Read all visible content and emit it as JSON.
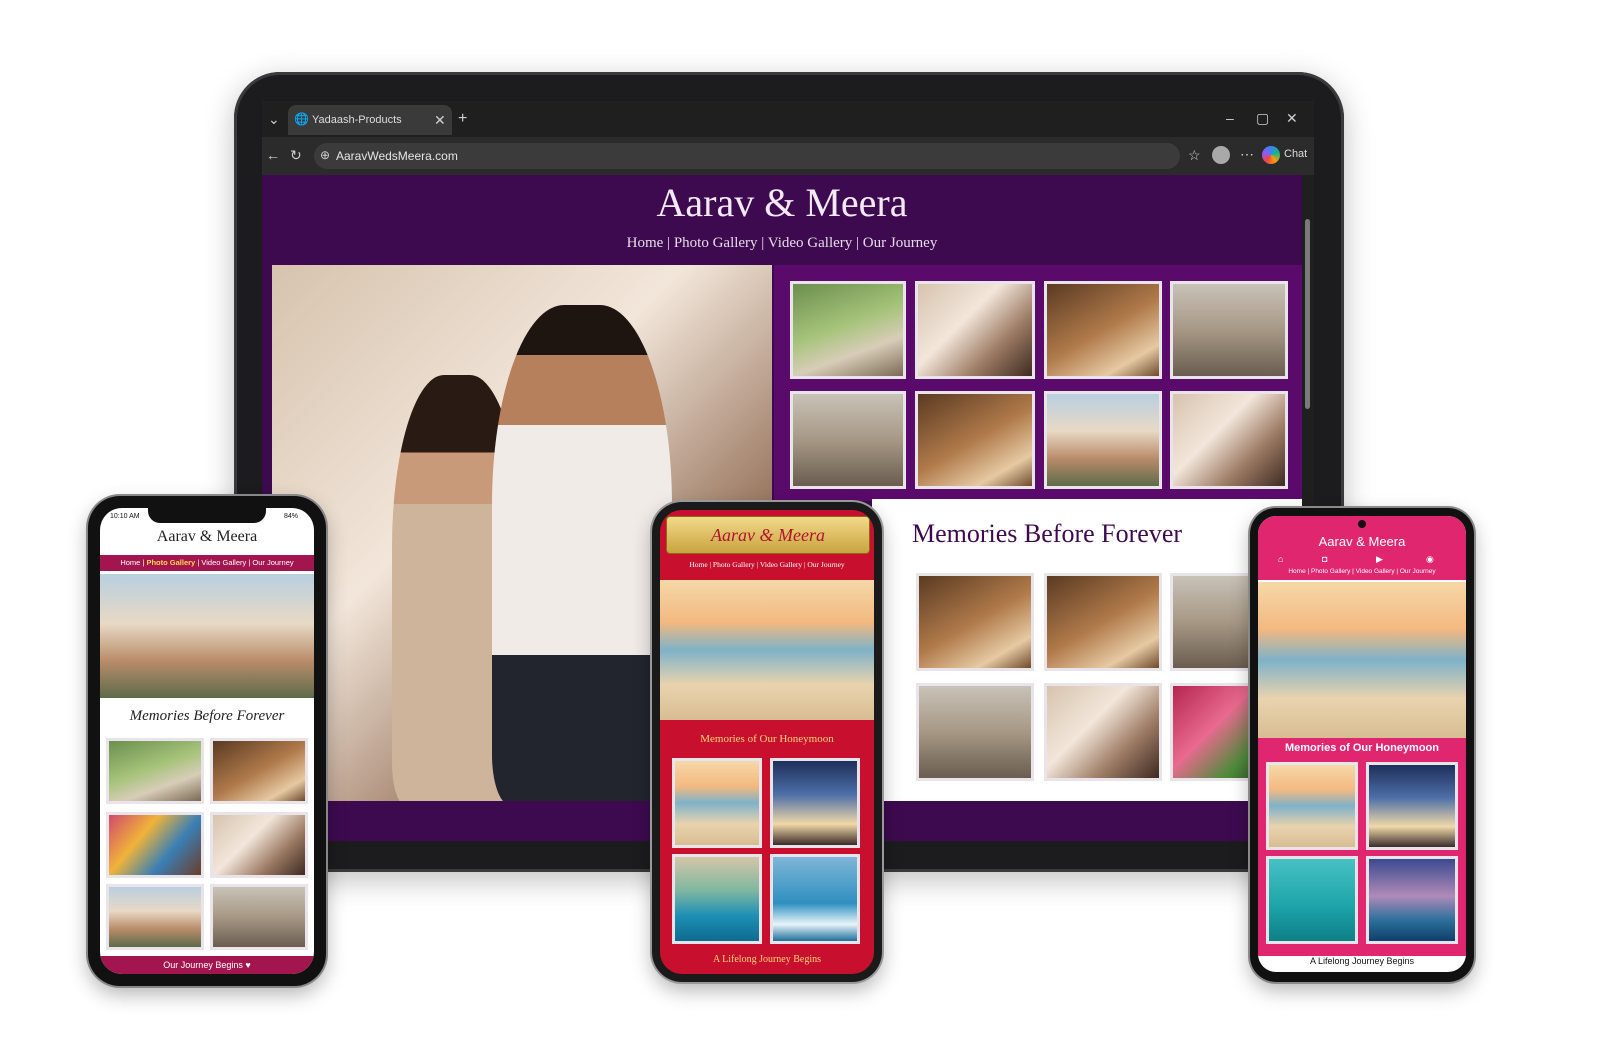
{
  "browser": {
    "tab_title": "Yadaash-Products",
    "url": "AaravWedsMeera.com",
    "chat_label": "Chat"
  },
  "site": {
    "title": "Aarav & Meera",
    "nav": "Home  |  Photo Gallery  |  Video Gallery  |  Our Journey",
    "memories_title": "Memories Before Forever"
  },
  "phone1": {
    "time": "10:10 AM",
    "battery": "84%",
    "title": "Aarav & Meera",
    "nav_home": "Home",
    "nav_photo": "Photo Gallery",
    "nav_video": "Video Gallery",
    "nav_journey": "Our Journey",
    "section_title": "Memories Before Forever",
    "footer": "Our Journey Begins ♥"
  },
  "phone2": {
    "title": "Aarav & Meera",
    "nav": "Home | Photo Gallery | Video Gallery | Our Journey",
    "section_title": "Memories of Our Honeymoon",
    "footer": "A Lifelong Journey Begins"
  },
  "phone3": {
    "title": "Aarav & Meera",
    "nav": "Home  |  Photo Gallery  |  Video Gallery  |  Our Journey",
    "section_title": "Memories of Our Honeymoon",
    "footer": "A Lifelong Journey Begins"
  },
  "colors": {
    "desktop_bg": "#3d0a4f",
    "phone1_accent": "#a3154f",
    "phone2_bg": "#c8102e",
    "phone2_gold": "#d9b84a",
    "phone3_pink": "#e0266e"
  }
}
